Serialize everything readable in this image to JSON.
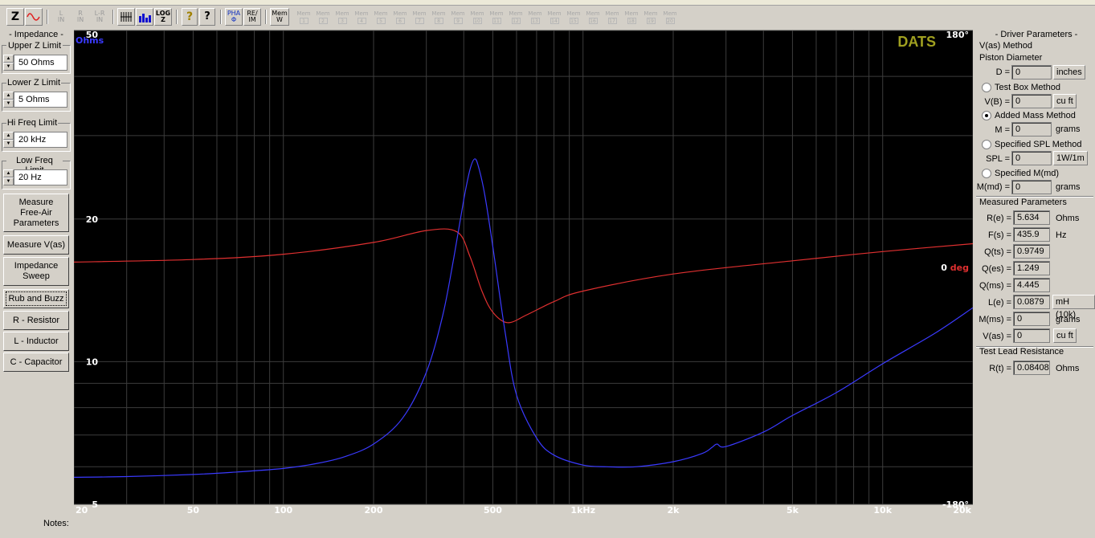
{
  "toolbar": {
    "z": "Z",
    "l_in": "L\nIN",
    "r_in": "R\nIN",
    "lr_in": "L-R\nIN",
    "log_z": "LOG\nZ",
    "help": "?",
    "help_ctx": "?",
    "pha": "PHA\nΦ",
    "re_im": "RE/\nIM",
    "mem_w": "Mem\nW",
    "mem_label": "Mem",
    "mem_slots": [
      "1",
      "2",
      "3",
      "4",
      "5",
      "6",
      "7",
      "8",
      "9",
      "10",
      "11",
      "12",
      "13",
      "14",
      "15",
      "16",
      "17",
      "18",
      "19",
      "20"
    ]
  },
  "left_panel": {
    "section_title": "- Impedance -",
    "upper_z": {
      "label": "Upper Z Limit",
      "value": "50 Ohms"
    },
    "lower_z": {
      "label": "Lower Z Limit",
      "value": "5 Ohms"
    },
    "hi_freq": {
      "label": "Hi Freq Limit",
      "value": "20 kHz"
    },
    "low_freq": {
      "label": "Low Freq Limit",
      "value": "20 Hz"
    },
    "buttons": {
      "measure_free_air": "Measure\nFree-Air\nParameters",
      "measure_vas": "Measure V(as)",
      "impedance_sweep": "Impedance\nSweep",
      "rub_and_buzz": "Rub and Buzz",
      "r_resistor": "R - Resistor",
      "l_inductor": "L - Inductor",
      "c_capacitor": "C - Capacitor"
    }
  },
  "chart_data": {
    "type": "line",
    "brand": "DATS",
    "left_axis": {
      "label": "Ohms",
      "scale": "log",
      "ylim": [
        5,
        50
      ],
      "ticks": [
        "50",
        "20",
        "10",
        "5"
      ]
    },
    "right_axis": {
      "ylim": [
        -180,
        180
      ],
      "ticks": [
        "180°",
        "0 deg",
        "-180°"
      ]
    },
    "x_axis": {
      "scale": "log",
      "xlim": [
        20,
        20000
      ],
      "ticks": [
        "20",
        "50",
        "100",
        "200",
        "500",
        "1kHz",
        "2k",
        "5k",
        "10k",
        "20k"
      ]
    },
    "grid": true,
    "colors": {
      "background": "#000000",
      "grid": "#3c3c3c",
      "impedance": "#3a3aff",
      "phase": "#e03030",
      "brand": "#a0a020",
      "ohms_label": "#3a3aff",
      "deg_label": "#e03030"
    },
    "series": [
      {
        "x": [
          20,
          30,
          50,
          70,
          100,
          130,
          160,
          200,
          250,
          300,
          340,
          370,
          400,
          420,
          435.9,
          450,
          470,
          500,
          550,
          600,
          700,
          800,
          1000,
          1200,
          1500,
          2000,
          2500,
          2700,
          2800,
          3000,
          4000,
          5000,
          7000,
          10000,
          15000,
          20000
        ],
        "values": [
          5.7,
          5.72,
          5.78,
          5.85,
          5.95,
          6.1,
          6.3,
          6.7,
          7.6,
          9.5,
          12.5,
          16.5,
          22.0,
          25.5,
          26.8,
          25.5,
          22.5,
          17.5,
          11.5,
          8.5,
          6.9,
          6.35,
          6.05,
          6.0,
          6.0,
          6.15,
          6.4,
          6.6,
          6.7,
          6.62,
          7.1,
          7.7,
          8.6,
          9.9,
          11.5,
          13.0
        ]
      },
      {
        "x": [
          20,
          50,
          100,
          200,
          300,
          380,
          420,
          460,
          500,
          560,
          650,
          800,
          1000,
          2000,
          5000,
          10000,
          20000
        ],
        "values": [
          4,
          6,
          10,
          19,
          28,
          27,
          8,
          -18,
          -34,
          -42,
          -36,
          -26,
          -18,
          -5,
          5,
          12,
          18
        ]
      }
    ]
  },
  "right_panel": {
    "title": "- Driver Parameters -",
    "vas_method": "V(as) Method",
    "piston_diameter": "Piston Diameter",
    "d": {
      "label": "D =",
      "value": "0",
      "unit": "inches"
    },
    "test_box": "Test Box Method",
    "vb": {
      "label": "V(B) =",
      "value": "0",
      "unit": "cu ft"
    },
    "added_mass": "Added Mass Method",
    "m": {
      "label": "M =",
      "value": "0",
      "unit": "grams"
    },
    "spl_method": "Specified SPL Method",
    "spl": {
      "label": "SPL =",
      "value": "0",
      "unit": "1W/1m"
    },
    "mmd_method": "Specified M(md)",
    "mmd": {
      "label": "M(md) =",
      "value": "0",
      "unit": "grams"
    },
    "measured_title": "Measured Parameters",
    "re": {
      "label": "R(e) =",
      "value": "5.634",
      "unit": "Ohms"
    },
    "fs": {
      "label": "F(s) =",
      "value": "435.9",
      "unit": "Hz"
    },
    "qts": {
      "label": "Q(ts) =",
      "value": "0.9749"
    },
    "qes": {
      "label": "Q(es) =",
      "value": "1.249"
    },
    "qms": {
      "label": "Q(ms) =",
      "value": "4.445"
    },
    "le": {
      "label": "L(e) =",
      "value": "0.0879",
      "unit": "mH (10k)"
    },
    "mms": {
      "label": "M(ms) =",
      "value": "0",
      "unit": "grams"
    },
    "vas": {
      "label": "V(as) =",
      "value": "0",
      "unit": "cu ft"
    },
    "lead_title": "Test Lead Resistance",
    "rt": {
      "label": "R(t) =",
      "value": "0.08408",
      "unit": "Ohms"
    }
  },
  "notes_label": "Notes:"
}
